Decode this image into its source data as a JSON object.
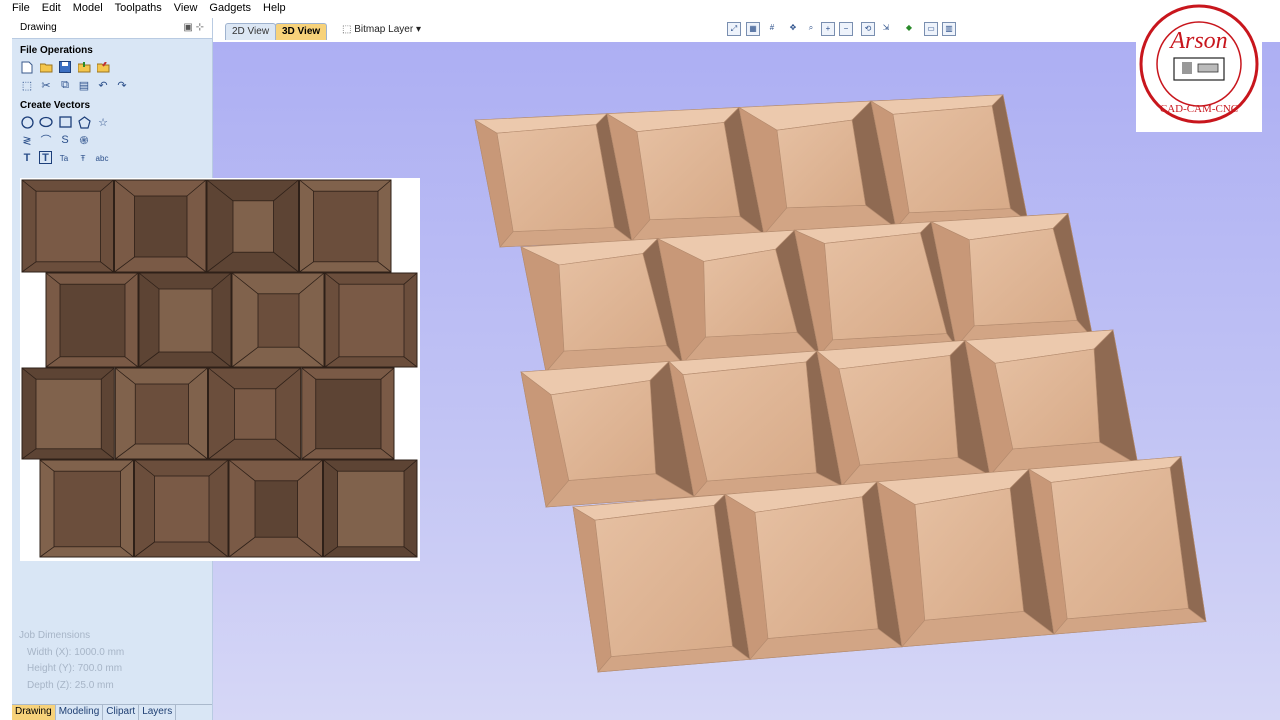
{
  "menu": [
    "File",
    "Edit",
    "Model",
    "Toolpaths",
    "View",
    "Gadgets",
    "Help"
  ],
  "panel": {
    "title": "Drawing",
    "file_ops_heading": "File Operations",
    "create_vectors_heading": "Create Vectors"
  },
  "job": {
    "heading": "Job Dimensions",
    "width": "Width  (X): 1000.0 mm",
    "height": "Height (Y): 700.0 mm",
    "depth": "Depth  (Z): 25.0 mm"
  },
  "bottom_tabs": [
    "Drawing",
    "Modeling",
    "Clipart",
    "Layers"
  ],
  "view_tabs": {
    "tab_2d": "2D View",
    "tab_3d": "3D View",
    "active": "3D View"
  },
  "layer_selector": "Bitmap Layer",
  "logo": {
    "text_top": "Arson",
    "text_bottom": "CAD-CAM-CNC",
    "color": "#c8161d"
  },
  "colors": {
    "viewport_top": "#adaff3",
    "viewport_bottom": "#d6d7f6",
    "active_tab": "#f7d27a",
    "panel_bg": "#d9e6f5",
    "wood_light": "#e2b898",
    "wood_dark": "#7c5a46"
  },
  "icons": {
    "file_ops_row1": [
      "new-file-icon",
      "open-folder-icon",
      "save-icon",
      "import-icon",
      "export-icon"
    ],
    "file_ops_row2": [
      "select-icon",
      "cut-icon",
      "copy-icon",
      "paste-icon",
      "undo-icon",
      "redo-icon"
    ],
    "vectors_row1": [
      "circle-icon",
      "ellipse-icon",
      "rectangle-icon",
      "polygon-icon",
      "star-icon"
    ],
    "vectors_row2": [
      "polyline-icon",
      "arc-icon",
      "curve-icon",
      "spiral-icon"
    ],
    "vectors_row3": [
      "text-icon",
      "text-box-icon",
      "text-on-curve-icon",
      "text-arc-icon",
      "text-style-icon"
    ]
  }
}
